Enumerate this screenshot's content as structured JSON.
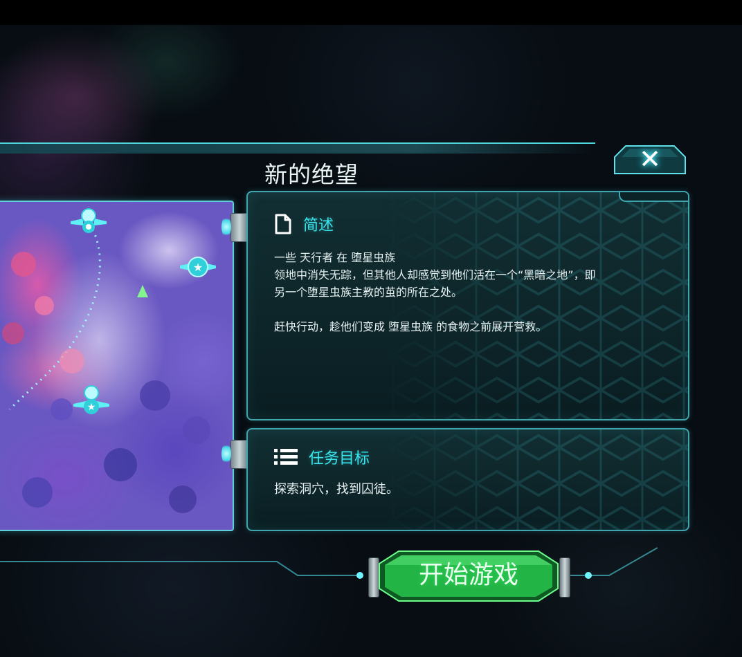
{
  "dialog": {
    "title": "新的绝望",
    "close_label": "✕"
  },
  "brief": {
    "icon": "document-icon",
    "title": "简述",
    "line1": "一些 天行者 在 堕星虫族",
    "line2": "领地中消失无踪，但其他人却感觉到他们活在一个“黑暗之地”，即",
    "line3": "另一个堕星虫族主教的茧的所在之处。",
    "line4": "赶快行动，趁他们变成 堕星虫族 的食物之前展开营救。"
  },
  "objective": {
    "icon": "list-icon",
    "title": "任务目标",
    "text": "探索洞穴，找到囚徒。"
  },
  "start": {
    "label": "开始游戏"
  },
  "colors": {
    "accent_cyan": "#39e4ec",
    "start_green": "#2fd45a",
    "panel_border": "#3fa6b0"
  },
  "map": {
    "icons": [
      "skull-wing-badge-icon",
      "star-wing-badge-icon",
      "skull-wing-badge-icon",
      "crystal-icon"
    ]
  }
}
